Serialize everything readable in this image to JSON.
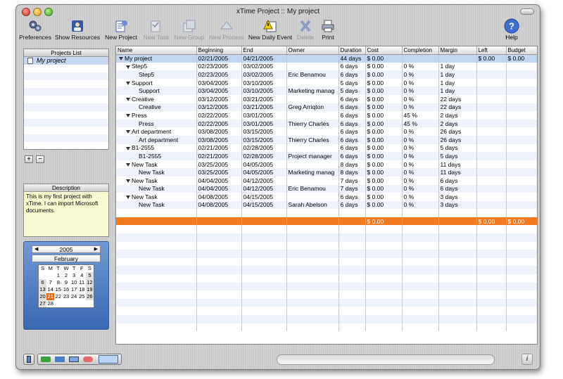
{
  "window": {
    "title": "xTime Project :: My project"
  },
  "toolbar": [
    {
      "name": "preferences",
      "label": "Preferences",
      "icon": "gears-icon",
      "enabled": true
    },
    {
      "name": "show-resources",
      "label": "Show Resources",
      "icon": "person-icon",
      "enabled": true
    },
    {
      "name": "new-project",
      "label": "New Project",
      "icon": "new-project-icon",
      "enabled": true
    },
    {
      "name": "new-task",
      "label": "New Task",
      "icon": "new-task-icon",
      "enabled": false
    },
    {
      "name": "new-group",
      "label": "New Group",
      "icon": "new-group-icon",
      "enabled": false
    },
    {
      "name": "new-process",
      "label": "New Process",
      "icon": "new-process-icon",
      "enabled": false
    },
    {
      "name": "new-daily-event",
      "label": "New Daily Event",
      "icon": "warning-calendar-icon",
      "enabled": true
    },
    {
      "name": "delete",
      "label": "Delete",
      "icon": "x-icon",
      "enabled": false
    },
    {
      "name": "print",
      "label": "Print",
      "icon": "printer-icon",
      "enabled": true
    }
  ],
  "help": {
    "label": "Help",
    "glyph": "?"
  },
  "projects": {
    "header": "Projects List",
    "items": [
      "My project"
    ],
    "add": "+",
    "remove": "−"
  },
  "description": {
    "header": "Description",
    "text": "This is my first project with xTime. I can import Microsoft documents."
  },
  "calendar": {
    "year": "2005",
    "month": "February",
    "prev": "◀",
    "next": "▶",
    "days": [
      "S",
      "M",
      "T",
      "W",
      "T",
      "F",
      "S"
    ],
    "weeks": [
      [
        "",
        "",
        "1",
        "2",
        "3",
        "4",
        "5"
      ],
      [
        "6",
        "7",
        "8",
        "9",
        "10",
        "11",
        "12"
      ],
      [
        "13",
        "14",
        "15",
        "16",
        "17",
        "18",
        "19"
      ],
      [
        "20",
        "21",
        "22",
        "23",
        "24",
        "25",
        "26"
      ],
      [
        "27",
        "28",
        "",
        "",
        "",
        "",
        ""
      ]
    ],
    "selected": "21"
  },
  "table": {
    "columns": [
      "Name",
      "Beginning",
      "End",
      "Owner",
      "Duration",
      "Cost",
      "Completion",
      "Margin",
      "Left",
      "Budget"
    ],
    "rows": [
      {
        "level": 0,
        "group": true,
        "name": "My project",
        "begin": "02/21/2005",
        "end": "04/21/2005",
        "owner": "",
        "duration": "44 days",
        "cost": "$ 0.00",
        "completion": "",
        "margin": "",
        "left": "$ 0.00",
        "budget": "$ 0.00"
      },
      {
        "level": 1,
        "group": true,
        "name": "Step5",
        "begin": "02/23/2005",
        "end": "03/02/2005",
        "owner": "",
        "duration": "6 days",
        "cost": "$ 0.00",
        "completion": "0 %",
        "margin": "1 day",
        "left": "",
        "budget": ""
      },
      {
        "level": 2,
        "group": false,
        "name": "Step5",
        "begin": "02/23/2005",
        "end": "03/02/2005",
        "owner": "Eric Benamou",
        "duration": "6 days",
        "cost": "$ 0.00",
        "completion": "0 %",
        "margin": "1 day",
        "left": "",
        "budget": ""
      },
      {
        "level": 1,
        "group": true,
        "name": "Support",
        "begin": "03/04/2005",
        "end": "03/10/2005",
        "owner": "",
        "duration": "5 days",
        "cost": "$ 0.00",
        "completion": "0 %",
        "margin": "1 day",
        "left": "",
        "budget": ""
      },
      {
        "level": 2,
        "group": false,
        "name": "Support",
        "begin": "03/04/2005",
        "end": "03/10/2005",
        "owner": "Marketing manag",
        "duration": "5 days",
        "cost": "$ 0.00",
        "completion": "0 %",
        "margin": "1 day",
        "left": "",
        "budget": ""
      },
      {
        "level": 1,
        "group": true,
        "name": "Creative",
        "begin": "03/12/2005",
        "end": "03/21/2005",
        "owner": "",
        "duration": "6 days",
        "cost": "$ 0.00",
        "completion": "0 %",
        "margin": "22 days",
        "left": "",
        "budget": ""
      },
      {
        "level": 2,
        "group": false,
        "name": "Creative",
        "begin": "03/12/2005",
        "end": "03/21/2005",
        "owner": "Greg Arriqton",
        "duration": "6 days",
        "cost": "$ 0.00",
        "completion": "0 %",
        "margin": "22 days",
        "left": "",
        "budget": ""
      },
      {
        "level": 1,
        "group": true,
        "name": "Press",
        "begin": "02/22/2005",
        "end": "03/01/2005",
        "owner": "",
        "duration": "6 days",
        "cost": "$ 0.00",
        "completion": "45 %",
        "margin": "2 days",
        "left": "",
        "budget": ""
      },
      {
        "level": 2,
        "group": false,
        "name": "Press",
        "begin": "02/22/2005",
        "end": "03/01/2005",
        "owner": "Thierry Charles",
        "duration": "6 days",
        "cost": "$ 0.00",
        "completion": "45 %",
        "margin": "2 days",
        "left": "",
        "budget": ""
      },
      {
        "level": 1,
        "group": true,
        "name": "Art department",
        "begin": "03/08/2005",
        "end": "03/15/2005",
        "owner": "",
        "duration": "6 days",
        "cost": "$ 0.00",
        "completion": "0 %",
        "margin": "26 days",
        "left": "",
        "budget": ""
      },
      {
        "level": 2,
        "group": false,
        "name": "Art department",
        "begin": "03/08/2005",
        "end": "03/15/2005",
        "owner": "Thierry Charles",
        "duration": "6 days",
        "cost": "$ 0.00",
        "completion": "0 %",
        "margin": "26 days",
        "left": "",
        "budget": ""
      },
      {
        "level": 1,
        "group": true,
        "name": "B1-2555",
        "begin": "02/21/2005",
        "end": "02/28/2005",
        "owner": "",
        "duration": "6 days",
        "cost": "$ 0.00",
        "completion": "0 %",
        "margin": "5 days",
        "left": "",
        "budget": ""
      },
      {
        "level": 2,
        "group": false,
        "name": "B1-2555",
        "begin": "02/21/2005",
        "end": "02/28/2005",
        "owner": "Project manager",
        "duration": "6 days",
        "cost": "$ 0.00",
        "completion": "0 %",
        "margin": "5 days",
        "left": "",
        "budget": ""
      },
      {
        "level": 1,
        "group": true,
        "name": "New Task",
        "begin": "03/25/2005",
        "end": "04/05/2005",
        "owner": "",
        "duration": "8 days",
        "cost": "$ 0.00",
        "completion": "0 %",
        "margin": "11 days",
        "left": "",
        "budget": ""
      },
      {
        "level": 2,
        "group": false,
        "name": "New Task",
        "begin": "03/25/2005",
        "end": "04/05/2005",
        "owner": "Marketing manag",
        "duration": "8 days",
        "cost": "$ 0.00",
        "completion": "0 %",
        "margin": "11 days",
        "left": "",
        "budget": ""
      },
      {
        "level": 1,
        "group": true,
        "name": "New Task",
        "begin": "04/04/2005",
        "end": "04/12/2005",
        "owner": "",
        "duration": "7 days",
        "cost": "$ 0.00",
        "completion": "0 %",
        "margin": "6 days",
        "left": "",
        "budget": ""
      },
      {
        "level": 2,
        "group": false,
        "name": "New Task",
        "begin": "04/04/2005",
        "end": "04/12/2005",
        "owner": "Eric Benamou",
        "duration": "7 days",
        "cost": "$ 0.00",
        "completion": "0 %",
        "margin": "6 days",
        "left": "",
        "budget": ""
      },
      {
        "level": 1,
        "group": true,
        "name": "New Task",
        "begin": "04/08/2005",
        "end": "04/15/2005",
        "owner": "",
        "duration": "6 days",
        "cost": "$ 0.00",
        "completion": "0 %",
        "margin": "3 days",
        "left": "",
        "budget": ""
      },
      {
        "level": 2,
        "group": false,
        "name": "New Task",
        "begin": "04/08/2005",
        "end": "04/15/2005",
        "owner": "Sarah Abelson",
        "duration": "6 days",
        "cost": "$ 0.00",
        "completion": "0 %",
        "margin": "3 days",
        "left": "",
        "budget": ""
      }
    ],
    "totals": {
      "cost": "$ 0.00",
      "left": "$ 0.00",
      "budget": "$ 0.00"
    }
  },
  "colors": {
    "accent": "#f17a1e",
    "selection": "#c3d6ef",
    "stripe": "#edf2fb",
    "calendar": "#4a78c0"
  },
  "bottom_icons": [
    "layout-icon",
    "resources-icon",
    "gantt-icon",
    "calendar-view-icon",
    "people-icon",
    "table-view-icon"
  ],
  "info": {
    "glyph": "i"
  }
}
